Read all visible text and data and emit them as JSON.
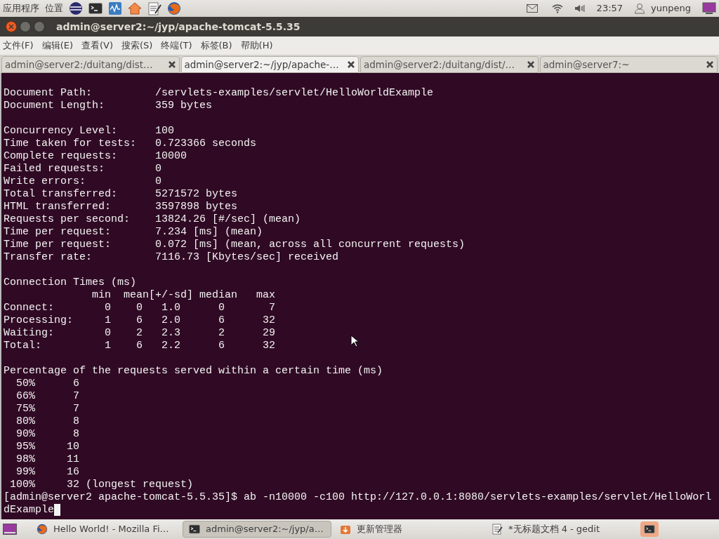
{
  "top_panel": {
    "menus": [
      "应用程序",
      "位置"
    ],
    "clock": "23:57",
    "user": "yunpeng"
  },
  "window": {
    "title": "admin@server2:~/jyp/apache-tomcat-5.5.35"
  },
  "menu_bar": [
    "文件(F)",
    "编辑(E)",
    "查看(V)",
    "搜索(S)",
    "终端(T)",
    "标签(B)",
    "帮助(H)"
  ],
  "tabs": [
    {
      "label": "admin@server2:/duitang/dist…",
      "selected": false
    },
    {
      "label": "admin@server2:~/jyp/apache-…",
      "selected": true
    },
    {
      "label": "admin@server2:/duitang/dist/…",
      "selected": false
    },
    {
      "label": "admin@server7:~",
      "selected": false
    }
  ],
  "terminal": {
    "cursor_visible": true,
    "blocks": [
      [
        "Document Path:          /servlets-examples/servlet/HelloWorldExample",
        "Document Length:        359 bytes"
      ],
      [
        "Concurrency Level:      100",
        "Time taken for tests:   0.723366 seconds",
        "Complete requests:      10000",
        "Failed requests:        0",
        "Write errors:           0",
        "Total transferred:      5271572 bytes",
        "HTML transferred:       3597898 bytes",
        "Requests per second:    13824.26 [#/sec] (mean)",
        "Time per request:       7.234 [ms] (mean)",
        "Time per request:       0.072 [ms] (mean, across all concurrent requests)",
        "Transfer rate:          7116.73 [Kbytes/sec] received"
      ],
      [
        "Connection Times (ms)",
        "              min  mean[+/-sd] median   max",
        "Connect:        0    0   1.0      0       7",
        "Processing:     1    6   2.0      6      32",
        "Waiting:        0    2   2.3      2      29",
        "Total:          1    6   2.2      6      32"
      ],
      [
        "Percentage of the requests served within a certain time (ms)",
        "  50%      6",
        "  66%      7",
        "  75%      7",
        "  80%      8",
        "  90%      8",
        "  95%     10",
        "  98%     11",
        "  99%     16",
        " 100%     32 (longest request)",
        "[admin@server2 apache-tomcat-5.5.35]$ ab -n10000 -c100 http://127.0.0.1:8080/servlets-examples/servlet/HelloWorl",
        "dExample"
      ]
    ]
  },
  "taskbar": {
    "items": [
      {
        "kind": "firefox",
        "label": "Hello World! - Mozilla Fi…",
        "selected": false
      },
      {
        "kind": "terminal",
        "label": "admin@server2:~/jyp/a…",
        "selected": true
      },
      {
        "kind": "updater",
        "label": "更新管理器",
        "selected": false
      },
      {
        "kind": "editor",
        "label": "*无标题文档 4 - gedit",
        "selected": false
      }
    ]
  }
}
